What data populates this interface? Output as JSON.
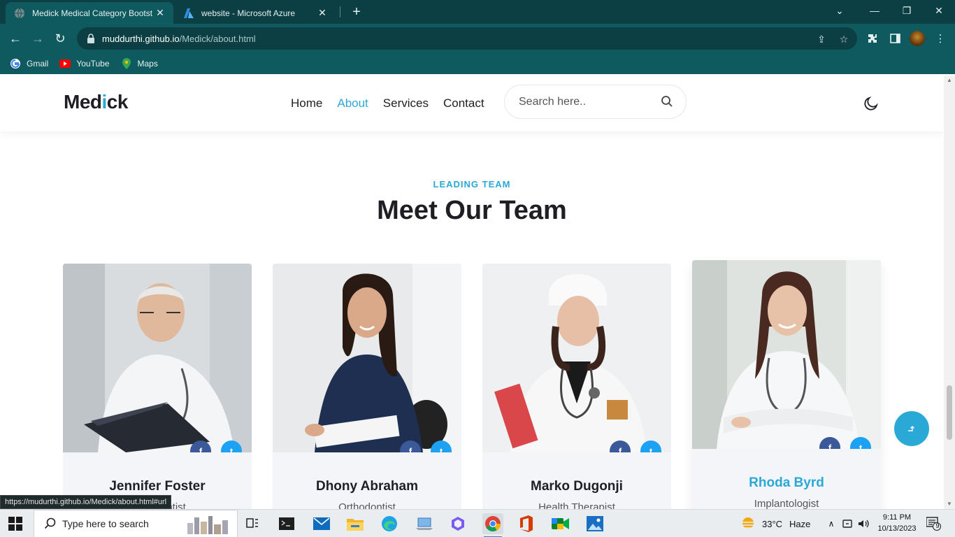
{
  "browser": {
    "tabs": [
      {
        "title": "Medick Medical Category Bootst",
        "active": true
      },
      {
        "title": "website - Microsoft Azure",
        "active": false
      }
    ],
    "url_host": "muddurthi.github.io",
    "url_path": "/Medick/about.html",
    "bookmarks": [
      {
        "label": "Gmail",
        "icon": "gmail-icon"
      },
      {
        "label": "YouTube",
        "icon": "youtube-icon"
      },
      {
        "label": "Maps",
        "icon": "maps-icon"
      }
    ],
    "status_url": "https://mudurthi.github.io/Medick/about.html#url"
  },
  "site": {
    "logo_main": "Med",
    "logo_accent": "i",
    "logo_end": "ck",
    "nav": [
      "Home",
      "About",
      "Services",
      "Contact"
    ],
    "active_nav": "About",
    "search_placeholder": "Search here..",
    "accent_color": "#2aa8d6"
  },
  "team_section": {
    "kicker": "LEADING TEAM",
    "title": "Meet Our Team",
    "members": [
      {
        "name": "Jennifer Foster",
        "role": "Orthodontist"
      },
      {
        "name": "Dhony Abraham",
        "role": "Orthodontist"
      },
      {
        "name": "Marko Dugonji",
        "role": "Health Therapist"
      },
      {
        "name": "Rhoda Byrd",
        "role": "Implantologist"
      }
    ],
    "social": {
      "facebook": "f",
      "twitter": "t"
    }
  },
  "taskbar": {
    "search_placeholder": "Type here to search",
    "weather_temp": "33°C",
    "weather_desc": "Haze",
    "time": "9:11 PM",
    "date": "10/13/2023",
    "notification_count": "9"
  }
}
